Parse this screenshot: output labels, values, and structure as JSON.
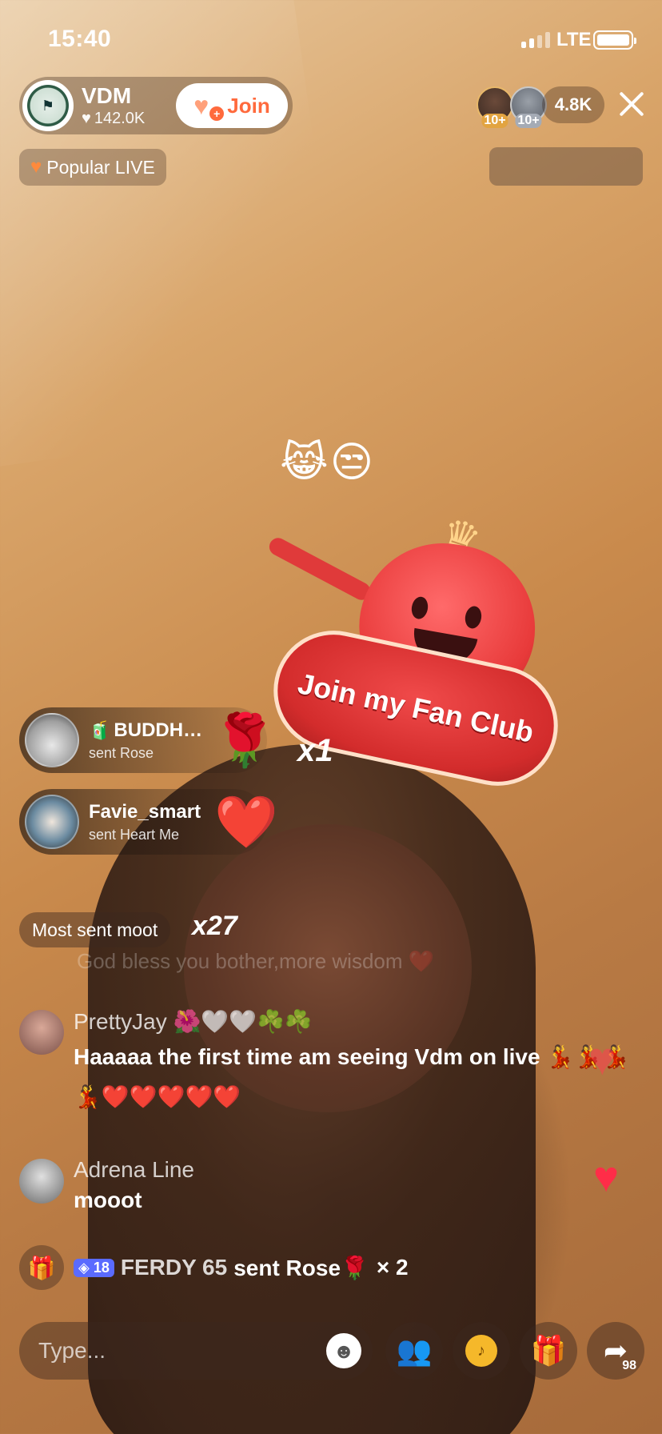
{
  "status_bar": {
    "time": "15:40",
    "network": "LTE"
  },
  "host": {
    "name": "VDM",
    "likes": "142.0K",
    "join_label": "Join",
    "avatar_text": "⚑"
  },
  "viewers": {
    "badge1": "10+",
    "badge2": "10+",
    "count": "4.8K"
  },
  "popular": {
    "label": "Popular LIVE"
  },
  "floating_emojis": "😹😒",
  "fan_club": {
    "banner_text": "Join my Fan Club"
  },
  "gifts": [
    {
      "prefix": "🧃",
      "user": "BUDDH…",
      "action": "sent Rose",
      "icon": "🌹",
      "multiplier": "x1"
    },
    {
      "prefix": "",
      "user": "Favie_smart",
      "action": "sent Heart Me",
      "icon": "❤️"
    }
  ],
  "most_sent": {
    "label": "Most sent moot",
    "multiplier": "x27"
  },
  "faded_comment": "God bless you bother,more wisdom ❤️",
  "comments": [
    {
      "user": "PrettyJay 🌺🤍🤍☘️☘️",
      "text": "Haaaaa the first time am seeing Vdm on live 💃💃💃💃❤️❤️❤️❤️❤️"
    },
    {
      "user": "Adrena Line",
      "text": "mooot"
    }
  ],
  "gift_row": {
    "level": "18",
    "user": "FERDY 65",
    "action": "sent Rose🌹",
    "multiplier": "× 2"
  },
  "input": {
    "placeholder": "Type..."
  },
  "share_count": "98",
  "colors": {
    "accent": "#ff6a3d",
    "heart": "#ff2d48"
  }
}
